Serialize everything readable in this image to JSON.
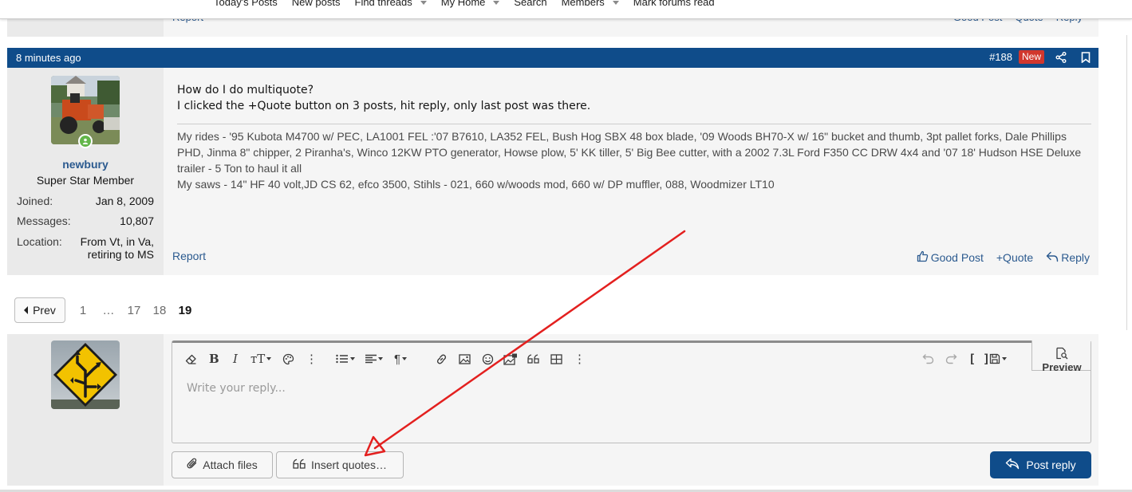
{
  "topnav": {
    "items": [
      {
        "label": "Today's Posts",
        "dropdown": false
      },
      {
        "label": "New posts",
        "dropdown": false
      },
      {
        "label": "Find threads",
        "dropdown": true
      },
      {
        "label": "My Home",
        "dropdown": true
      },
      {
        "label": "Search",
        "dropdown": false
      },
      {
        "label": "Members",
        "dropdown": true
      },
      {
        "label": "Mark forums read",
        "dropdown": false
      }
    ]
  },
  "prev_post": {
    "report": "Report",
    "good_post": "Good Post",
    "quote": "Quote",
    "reply": "Reply"
  },
  "post": {
    "time": "8 minutes ago",
    "number": "#188",
    "badge": "New",
    "user": {
      "name": "newbury",
      "title": "Super Star Member",
      "joined_label": "Joined:",
      "joined": "Jan 8, 2009",
      "messages_label": "Messages:",
      "messages": "10,807",
      "location_label": "Location:",
      "location_line1": "From Vt, in Va,",
      "location_line2": "retiring to MS"
    },
    "body_line1": "How do I do multiquote?",
    "body_line2": "I clicked the +Quote button on 3 posts, hit reply, only last post was there.",
    "signature_line1": "My rides - '95 Kubota M4700 w/ PEC, LA1001 FEL :'07 B7610, LA352 FEL, Bush Hog SBX 48 box blade, '09 Woods BH70-X w/ 16\" bucket and thumb, 3pt pallet forks, Dale Phillips",
    "signature_line2": "PHD, Jinma 8\" chipper, 2 Piranha's, Winco 12KW PTO generator, Howse plow, 5' KK tiller, 5' Big Bee cutter, with a 2002 7.3L Ford F350 CC DRW 4x4 and '07 18' Hudson HSE Deluxe",
    "signature_line3": "trailer - 5 Ton to haul it all",
    "signature_line4": "My saws - 14\" HF 40 volt,JD CS 62, efco 3500, Stihls - 021, 660 w/woods mod, 660 w/ DP muffler, 088, Woodmizer LT10",
    "report": "Report",
    "good_post": "Good Post",
    "quote": "+Quote",
    "reply": "Reply"
  },
  "pagination": {
    "prev": "Prev",
    "pages": [
      "1",
      "…",
      "17",
      "18",
      "19"
    ],
    "current": "19"
  },
  "editor": {
    "placeholder": "Write your reply...",
    "preview": "Preview",
    "attach": "Attach files",
    "insert_quotes": "Insert quotes…",
    "post_reply": "Post reply"
  },
  "colors": {
    "header_bg": "#0f4c8a",
    "badge_bg": "#d1372d",
    "link": "#2b5a8f",
    "annotation_arrow": "#e3201f"
  }
}
